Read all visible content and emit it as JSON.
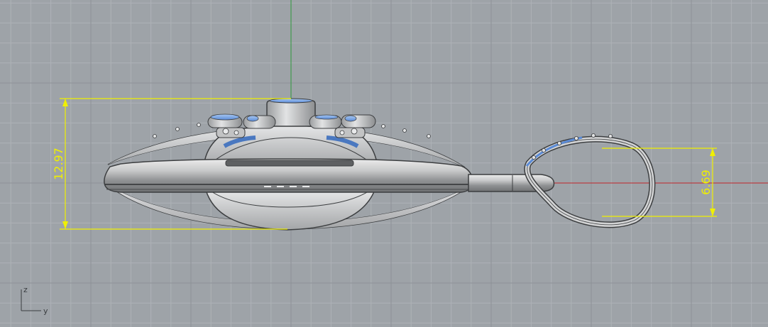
{
  "viewport": {
    "background": "#9ea3a8",
    "grid_minor_color": "#aeb2b7",
    "grid_major_color": "#8d9297",
    "axis_vertical_color": "#2e9a3c",
    "axis_horizontal_color": "#c0262a"
  },
  "dimensions": {
    "color": "#f0f000",
    "height_label": "12.97",
    "loop_label": "6.69"
  },
  "axis_triad": {
    "vertical_label": "z",
    "horizontal_label": "y",
    "color": "#3a3d40"
  },
  "model": {
    "metal_color": "#d4d5d6",
    "stone_color": "#7aa6e8"
  }
}
